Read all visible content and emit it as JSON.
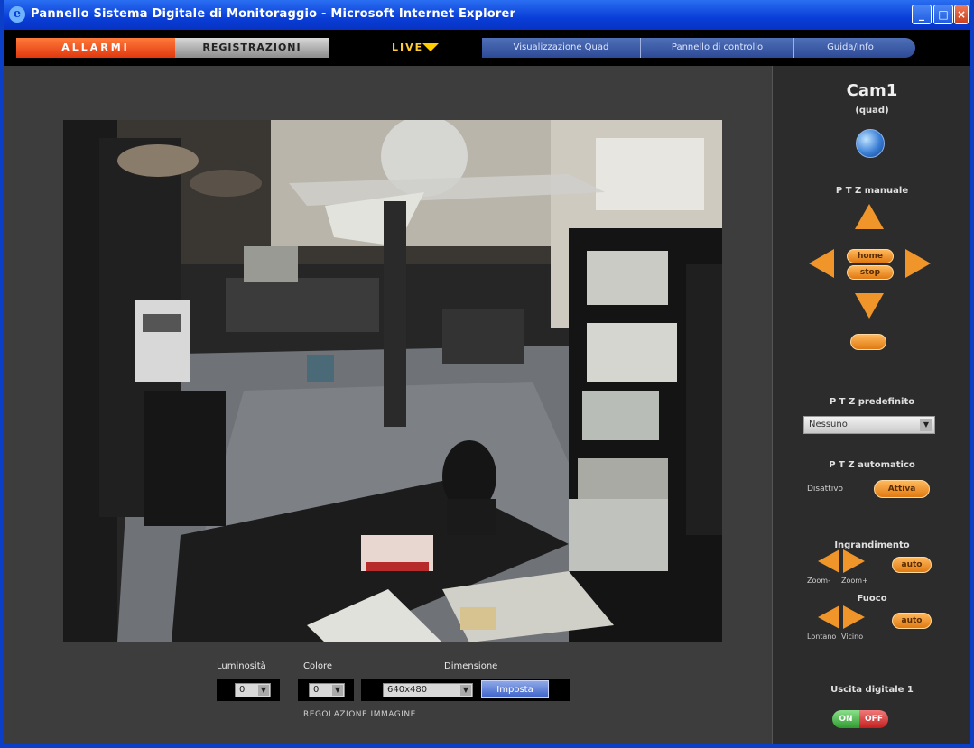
{
  "window": {
    "title": "Pannello Sistema Digitale di Monitoraggio - Microsoft Internet Explorer",
    "controls": {
      "minimize": "_",
      "maximize": "□",
      "close": "×"
    }
  },
  "nav": {
    "tab_allarmi": "ALLARMI",
    "tab_registrazioni": "REGISTRAZIONI",
    "live": "LIVE",
    "tabs_right": [
      "Visualizzazione Quad",
      "Pannello di controllo",
      "Guida/Info"
    ]
  },
  "video": {
    "description_alt": "Camera live feed"
  },
  "controls": {
    "luminosita_label": "Luminosità",
    "luminosita_value": "0",
    "colore_label": "Colore",
    "colore_value": "0",
    "dimensione_label": "Dimensione",
    "dimensione_value": "640x480",
    "set_button": "Imposta",
    "section_label": "REGOLAZIONE IMMAGINE"
  },
  "panel": {
    "camera_name": "Cam1",
    "camera_sub": "(quad)",
    "ptz_manual_label": "P T Z manuale",
    "ptz_home": "home",
    "ptz_stop": "stop",
    "ptz_preset_label": "P T Z predefinito",
    "ptz_preset_value": "Nessuno",
    "ptz_auto_label": "P T Z automatico",
    "ptz_auto_status": "Disattivo",
    "ptz_auto_button": "Attiva",
    "zoom_label": "Ingrandimento",
    "zoom_left": "Zoom-",
    "zoom_right": "Zoom+",
    "zoom_auto": "auto",
    "focus_label": "Fuoco",
    "focus_left": "Lontano",
    "focus_right": "Vicino",
    "focus_auto": "auto",
    "output_label": "Uscita digitale 1",
    "output_on": "ON",
    "output_off": "OFF"
  },
  "colors": {
    "title_bar": "#0a3ed8",
    "accent_orange": "#f0952a",
    "tab_red": "#e0380f",
    "panel_bg": "#2c2c2c",
    "body_bg": "#3d3d3d"
  }
}
